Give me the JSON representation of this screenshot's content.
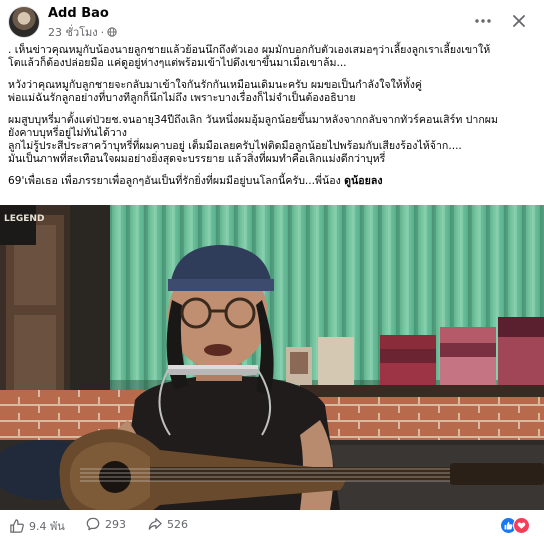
{
  "post": {
    "author": "Add Bao",
    "timestamp": "23 ชั่วโมง",
    "lines": [
      ".    เห็นข่าวคุณหมูกับน้องนายลูกชายแล้วย้อนนึกถึงตัวเอง ผมมักบอกกับตัวเองเสมอๆว่าเลี้ยงลูกเราเลี้ยงเขาให้",
      "โตแล้วก็ต้องปล่อยมือ แค่ดูอยู่ห่างๆแต่พร้อมเข้าไปดึงเขาขึ้นมาเมื่อเขาล้ม...",
      "หวังว่าคุณหมูกับลูกชายจะกลับมาเข้าใจกันรักกันเหมือนเดิมนะครับ ผมขอเป็นกำลังใจให้ทั้งคู่",
      "พ่อแม่ฉันรักลูกอย่างที่บางทีลูกก็นึกไม่ถึง เพราะบางเรื่องก็ไม่จำเป็นต้องอธิบาย",
      "ผมสูบบุหรี่มาตั้งแต่ป่วยช.จนอายุ34ปีถึงเลิก วันหนึ่งผมอุ้มลูกน้อยขึ้นมาหลังจากกลับจากทัวร์คอนเสิร์ท ปากผม",
      "ยังคาบบุหรี่อยู่ไม่ทันได้วาง",
      "ลูกไม่รู้ประสีประสาคว้าบุหรี่ที่ผมคาบอยู่ เต็มมือเลยครับไฟติดมือลูกน้อยไปพร้อมกับเสียงร้องไห้จ้าก....",
      "มันเป็นภาพที่สะเทือนใจผมอย่างยิ่งสุดจะบรรยาย แล้วสิ่งที่ผมทำคือเลิกแม่งดีกว่าบุหรี่"
    ],
    "closing_prefix": "69'เพื่อเธอ เพื่อภรรยาเพื่อลูกๆอันเป็นที่รักยิ่งที่ผมมีอยู่บนโลกนี้ครับ...พี่น้อง ",
    "closing_tag": "ดูน้อยลง"
  },
  "photo": {
    "banner_text": "LEGEND",
    "palette": {
      "curtain": "#6bbf9a",
      "wall": "#b86a4c",
      "shirt": "#1f1c1b",
      "guitar": "#6a4a2d",
      "bandana": "#2f3c5a"
    }
  },
  "footer": {
    "likes": "9.4 พัน",
    "comments": "293",
    "shares": "526",
    "like_color": "#1877f2",
    "love_color": "#f33e58"
  },
  "icons": {
    "privacy": "globe-icon",
    "more": "more-dots-icon",
    "close": "close-icon",
    "like": "thumbs-up-icon",
    "comment": "comment-bubble-icon",
    "share": "share-arrow-icon",
    "reaction_like": "like-reaction-icon",
    "reaction_love": "love-reaction-icon"
  }
}
